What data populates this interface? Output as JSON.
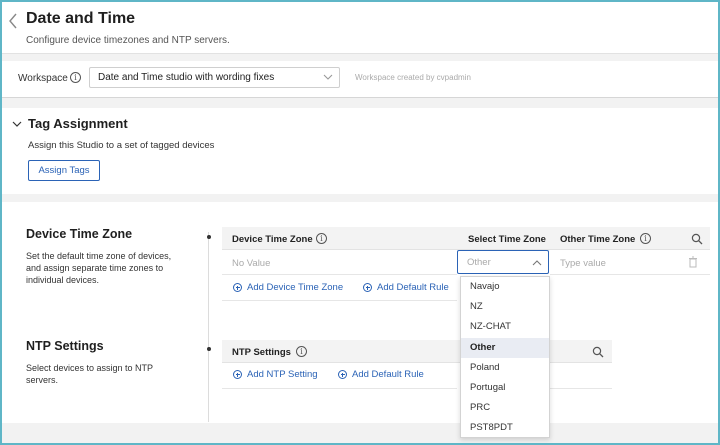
{
  "header": {
    "title": "Date and Time",
    "subtitle": "Configure device timezones and NTP servers."
  },
  "workspace": {
    "label": "Workspace",
    "selected": "Date and Time studio with wording fixes",
    "created_by": "Workspace created by cvpadmin"
  },
  "tag_assignment": {
    "title": "Tag Assignment",
    "description": "Assign this Studio to a set of tagged devices",
    "button_label": "Assign Tags"
  },
  "device_time_zone": {
    "title": "Device Time Zone",
    "description_lines": [
      "Set the default time zone of devices,",
      "and assign separate time zones to",
      "individual devices."
    ],
    "columns": [
      "Device Time Zone",
      "Select Time Zone",
      "Other Time Zone"
    ],
    "row": {
      "device_placeholder": "No Value",
      "select_placeholder": "Other",
      "other_placeholder": "Type value"
    },
    "add_button": "Add Device Time Zone",
    "add_rule_button": "Add Default Rule"
  },
  "ntp_settings": {
    "title": "NTP Settings",
    "description_lines": [
      "Select devices to assign to NTP",
      "servers."
    ],
    "column": "NTP Settings",
    "add_button": "Add NTP Setting",
    "add_rule_button": "Add Default Rule"
  },
  "timezone_dropdown": {
    "options": [
      "Navajo",
      "NZ",
      "NZ-CHAT",
      "Other",
      "Poland",
      "Portugal",
      "PRC",
      "PST8PDT"
    ],
    "highlighted": "Other"
  },
  "colors": {
    "accent": "#2b63b6",
    "frame": "#5fb6c7"
  }
}
